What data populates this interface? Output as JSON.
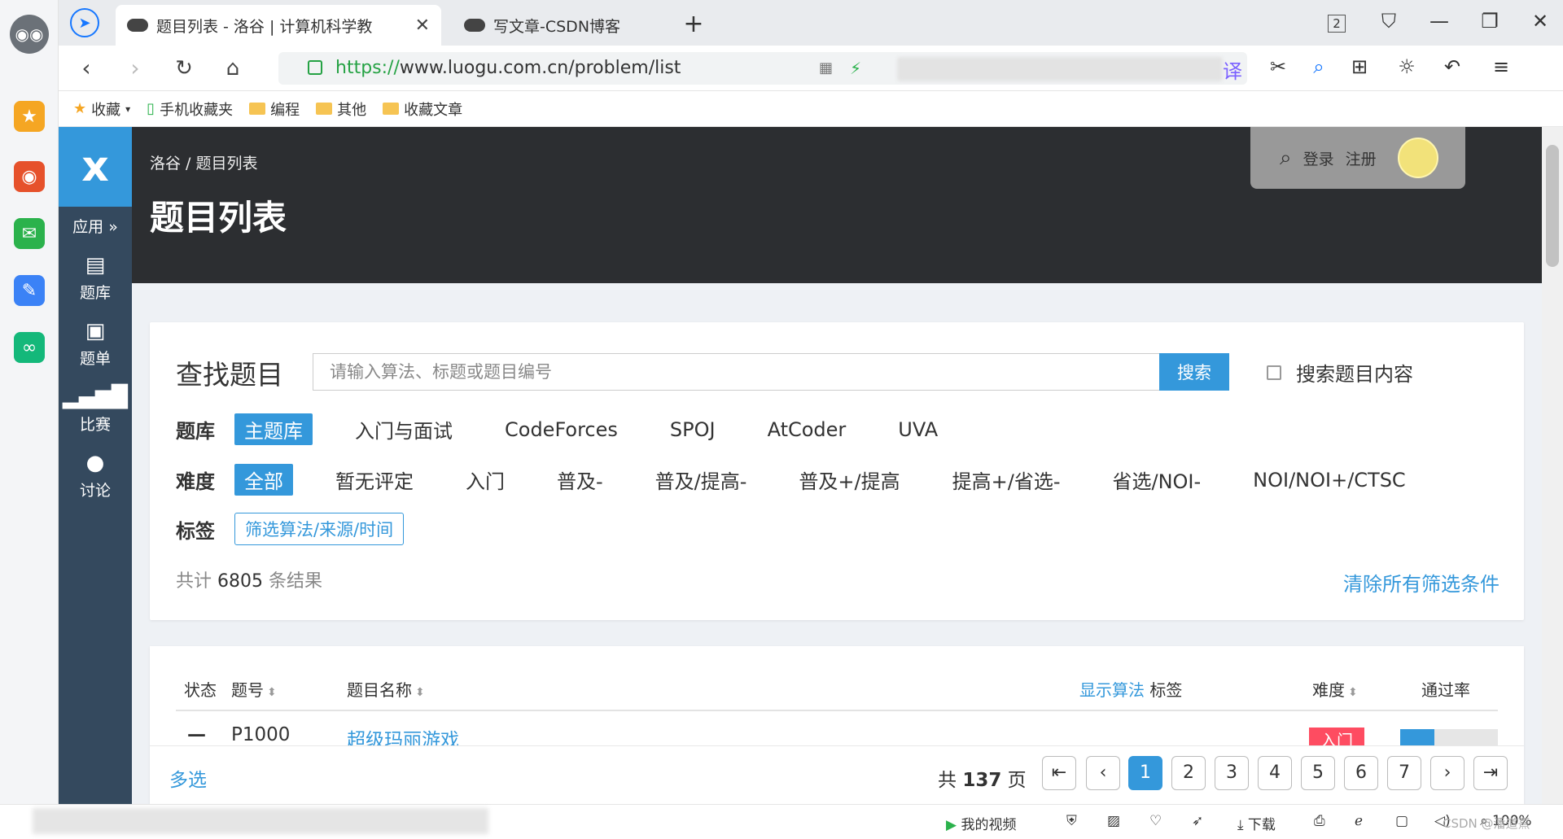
{
  "browser": {
    "tabs": [
      {
        "title": "题目列表 - 洛谷 | 计算机科学教"
      },
      {
        "title": "写文章-CSDN博客"
      }
    ],
    "new_tab_icon": "plus-icon",
    "window_badge": "2",
    "url_scheme": "https://",
    "url_rest": "www.luogu.com.cn/problem/list",
    "bookmarks": [
      {
        "label": "收藏",
        "icon": "star-icon"
      },
      {
        "label": "手机收藏夹",
        "icon": "phone-icon"
      },
      {
        "label": "编程",
        "icon": "folder-icon"
      },
      {
        "label": "其他",
        "icon": "folder-icon"
      },
      {
        "label": "收藏文章",
        "icon": "folder-icon"
      }
    ],
    "status": {
      "my_video": "我的视频",
      "download": "下载",
      "zoom": "100%",
      "watermark": "CSDN @潘道熹"
    }
  },
  "luogu": {
    "sidebar": {
      "apps": "应用",
      "items": [
        {
          "label": "题库",
          "icon": "book-icon"
        },
        {
          "label": "题单",
          "icon": "clipboard-icon"
        },
        {
          "label": "比赛",
          "icon": "signal-bars-icon"
        },
        {
          "label": "讨论",
          "icon": "chat-bubbles-icon"
        }
      ]
    },
    "header": {
      "breadcrumb": "洛谷 / 题目列表",
      "title": "题目列表",
      "login": "登录",
      "register": "注册"
    },
    "filter": {
      "heading": "查找题目",
      "search_placeholder": "请输入算法、标题或题目编号",
      "search_button": "搜索",
      "search_content_label": "搜索题目内容",
      "bank_label": "题库",
      "banks": [
        "主题库",
        "入门与面试",
        "CodeForces",
        "SPOJ",
        "AtCoder",
        "UVA"
      ],
      "difficulty_label": "难度",
      "difficulties": [
        "全部",
        "暂无评定",
        "入门",
        "普及-",
        "普及/提高-",
        "普及+/提高",
        "提高+/省选-",
        "省选/NOI-",
        "NOI/NOI+/CTSC"
      ],
      "tag_label": "标签",
      "tag_button": "筛选算法/来源/时间",
      "result_prefix": "共计",
      "result_count": "6805",
      "result_suffix": "条结果",
      "clear_all": "清除所有筛选条件"
    },
    "table": {
      "headers": {
        "status": "状态",
        "pid": "题号",
        "name": "题目名称",
        "show_algo": "显示算法",
        "tags": "标签",
        "difficulty": "难度",
        "pass_rate": "通过率"
      },
      "rows": [
        {
          "status": "—",
          "pid": "P1000",
          "name": "超级玛丽游戏",
          "difficulty": "入门",
          "difficulty_color": "#fe4c61",
          "pass_rate": 0.35
        }
      ]
    },
    "pager": {
      "multi_select": "多选",
      "total_prefix": "共",
      "total_pages": "137",
      "total_suffix": "页",
      "pages": [
        "1",
        "2",
        "3",
        "4",
        "5",
        "6",
        "7"
      ],
      "current": "1"
    },
    "colors": {
      "primary": "#3498db",
      "sidebar": "#34495e",
      "header": "#2c2e31",
      "intro_red": "#fe4c61"
    }
  }
}
